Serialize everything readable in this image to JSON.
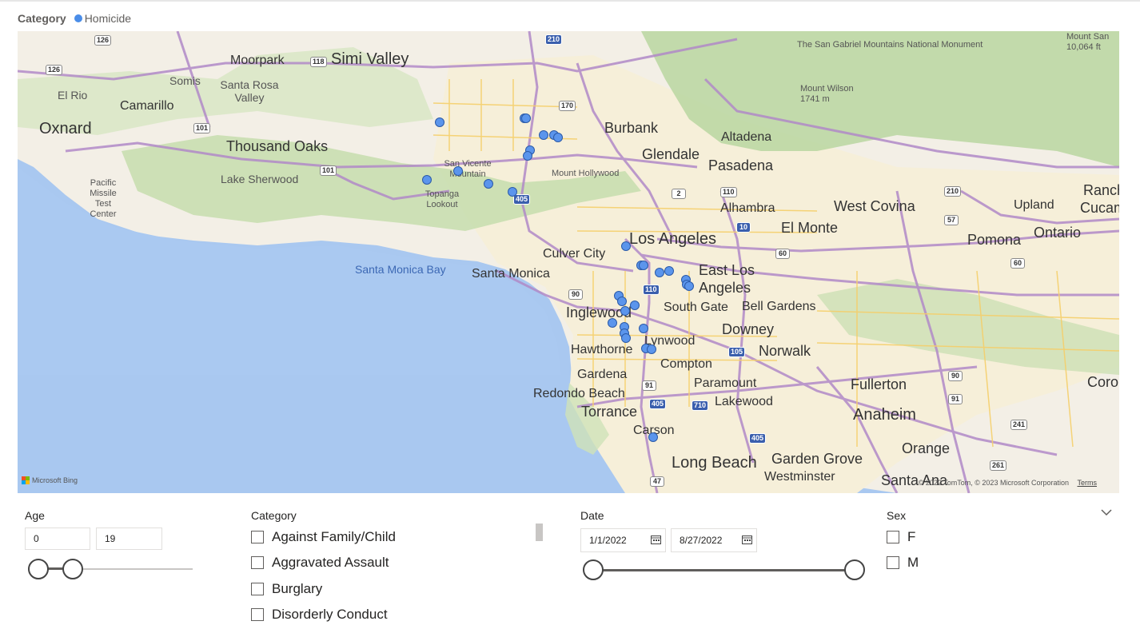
{
  "legend": {
    "title": "Category",
    "series_label": "Homicide",
    "series_color": "#4a8de8"
  },
  "map": {
    "attribution_logo": "Microsoft Bing",
    "copyright": "© 2022 TomTom, © 2023 Microsoft Corporation",
    "terms": "Terms",
    "labels": {
      "moorpark": "Moorpark",
      "simi_valley": "Simi Valley",
      "somis": "Somis",
      "santa_rosa_valley": "Santa Rosa Valley",
      "el_rio": "El Rio",
      "camarillo": "Camarillo",
      "oxnard": "Oxnard",
      "thousand_oaks": "Thousand Oaks",
      "lake_sherwood": "Lake Sherwood",
      "pacific_missile": "Pacific Missile Test Center",
      "san_vicente": "San Vicente Mountain",
      "topanga": "Topanga Lookout",
      "mount_hollywood": "Mount Hollywood",
      "burbank": "Burbank",
      "glendale": "Glendale",
      "altadena": "Altadena",
      "pasadena": "Pasadena",
      "sg_monument": "The San Gabriel Mountains National Monument",
      "mount_san": "Mount San 10,064 ft",
      "mount_wilson": "Mount Wilson 1741 m",
      "alhambra": "Alhambra",
      "west_covina": "West Covina",
      "el_monte": "El Monte",
      "pomona": "Pomona",
      "upland": "Upland",
      "ontario": "Ontario",
      "rancho": "Ranch",
      "cucamonga": "Cucamo",
      "los_angeles": "Los Angeles",
      "culver_city": "Culver City",
      "santa_monica": "Santa Monica",
      "santa_monica_bay": "Santa Monica Bay",
      "east_la": "East Los Angeles",
      "south_gate": "South Gate",
      "bell_gardens": "Bell Gardens",
      "inglewood": "Inglewood",
      "downey": "Downey",
      "lynwood": "Lynwood",
      "hawthorne": "Hawthorne",
      "norwalk": "Norwalk",
      "compton": "Compton",
      "gardena": "Gardena",
      "paramount": "Paramount",
      "redondo": "Redondo Beach",
      "lakewood": "Lakewood",
      "torrance": "Torrance",
      "fullerton": "Fullerton",
      "corona": "Coro",
      "anaheim": "Anaheim",
      "carson": "Carson",
      "orange": "Orange",
      "long_beach": "Long Beach",
      "garden_grove": "Garden Grove",
      "westminster": "Westminster",
      "santa_ana": "Santa Ana"
    },
    "shields": [
      "126",
      "126",
      "118",
      "101",
      "101",
      "405",
      "210",
      "170",
      "2",
      "110",
      "210",
      "57",
      "10",
      "60",
      "60",
      "90",
      "110",
      "105",
      "91",
      "405",
      "710",
      "405",
      "90",
      "91",
      "241",
      "261",
      "47"
    ],
    "homicide_points": [
      {
        "lat": 34.27,
        "lng": -118.61
      },
      {
        "lat": 34.275,
        "lng": -118.472
      },
      {
        "lat": 34.276,
        "lng": -118.469
      },
      {
        "lat": 34.252,
        "lng": -118.44
      },
      {
        "lat": 34.252,
        "lng": -118.424
      },
      {
        "lat": 34.248,
        "lng": -118.417
      },
      {
        "lat": 34.23,
        "lng": -118.463
      },
      {
        "lat": 34.222,
        "lng": -118.466
      },
      {
        "lat": 34.2,
        "lng": -118.58
      },
      {
        "lat": 34.188,
        "lng": -118.631
      },
      {
        "lat": 34.182,
        "lng": -118.531
      },
      {
        "lat": 34.17,
        "lng": -118.491
      },
      {
        "lat": 34.093,
        "lng": -118.306
      },
      {
        "lat": 34.065,
        "lng": -118.281
      },
      {
        "lat": 34.066,
        "lng": -118.277
      },
      {
        "lat": 34.055,
        "lng": -118.251
      },
      {
        "lat": 34.057,
        "lng": -118.236
      },
      {
        "lat": 34.045,
        "lng": -118.208
      },
      {
        "lat": 34.038,
        "lng": -118.207
      },
      {
        "lat": 34.036,
        "lng": -118.203
      },
      {
        "lat": 34.022,
        "lng": -118.318
      },
      {
        "lat": 34.014,
        "lng": -118.312
      },
      {
        "lat": 34.008,
        "lng": -118.292
      },
      {
        "lat": 34.0,
        "lng": -118.307
      },
      {
        "lat": 33.983,
        "lng": -118.328
      },
      {
        "lat": 33.978,
        "lng": -118.309
      },
      {
        "lat": 33.975,
        "lng": -118.277
      },
      {
        "lat": 33.968,
        "lng": -118.308
      },
      {
        "lat": 33.961,
        "lng": -118.306
      },
      {
        "lat": 33.947,
        "lng": -118.273
      },
      {
        "lat": 33.946,
        "lng": -118.264
      },
      {
        "lat": 33.82,
        "lng": -118.262
      }
    ]
  },
  "filters": {
    "age": {
      "title": "Age",
      "min": "0",
      "max": "19",
      "range": [
        0,
        19
      ]
    },
    "category": {
      "title": "Category",
      "options": [
        "Against Family/Child",
        "Aggravated Assault",
        "Burglary",
        "Disorderly Conduct"
      ]
    },
    "date": {
      "title": "Date",
      "start": "1/1/2022",
      "end": "8/27/2022"
    },
    "sex": {
      "title": "Sex",
      "options": [
        "F",
        "M"
      ]
    }
  },
  "icons": {
    "calendar": "calendar-icon",
    "expand": "chevron-down-icon"
  }
}
